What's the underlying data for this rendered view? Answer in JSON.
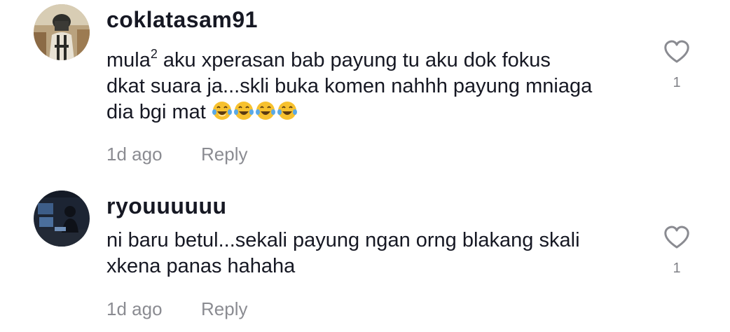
{
  "comments": [
    {
      "username": "coklatasam91",
      "avatar_icon": "avatar-soldier-icon",
      "text_line1_a": "mula",
      "text_line1_sup": "2",
      "text_line1_b": " aku xperasan bab payung tu aku dok fokus",
      "text_line2": "dkat suara ja...skli buka komen nahhh payung mniaga",
      "text_line3": "dia bgi mat",
      "emojis": [
        "face-with-tears-of-joy-icon",
        "face-with-tears-of-joy-icon",
        "face-with-tears-of-joy-icon",
        "face-with-tears-of-joy-icon"
      ],
      "time": "1d ago",
      "reply_label": "Reply",
      "like_count": "1"
    },
    {
      "username": "ryouuuuuu",
      "avatar_icon": "avatar-desk-scene-icon",
      "text_line1": "ni baru betul...sekali payung ngan orng blakang skali",
      "text_line2": "xkena panas hahaha",
      "time": "1d ago",
      "reply_label": "Reply",
      "like_count": "1"
    }
  ],
  "colors": {
    "text_primary": "#161823",
    "text_secondary": "#8a8b91",
    "emoji_yellow": "#f7c12e",
    "emoji_tear": "#5aa9e6"
  }
}
